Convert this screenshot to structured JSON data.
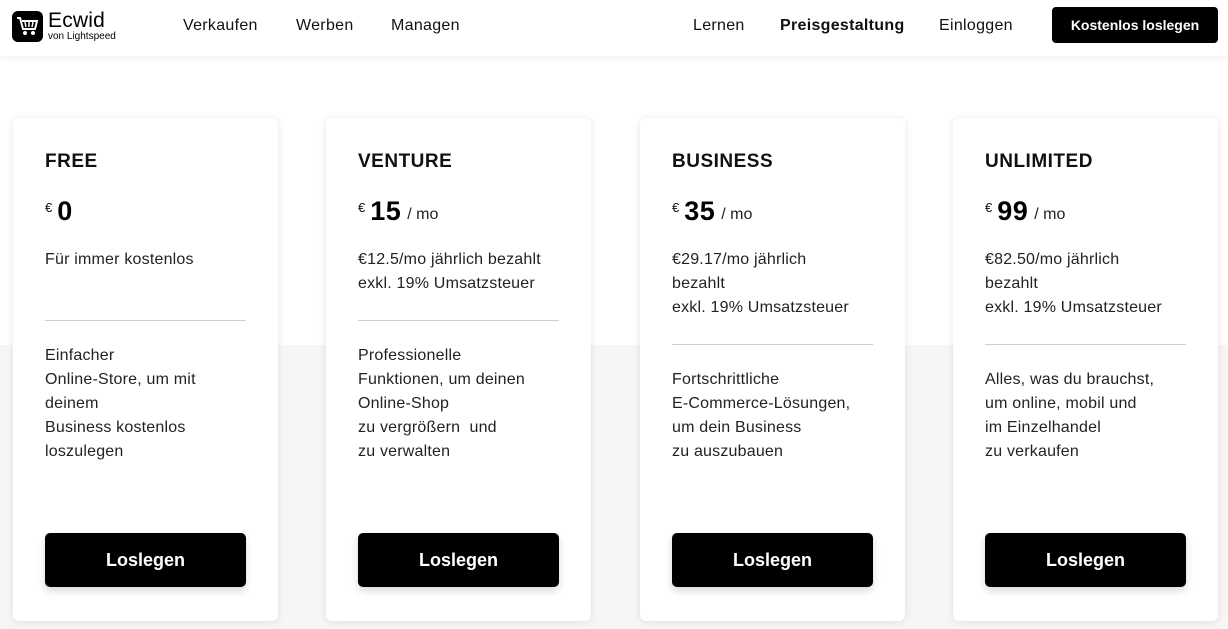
{
  "brand": {
    "name": "Ecwid",
    "sub": "von Lightspeed"
  },
  "nav": {
    "left": [
      "Verkaufen",
      "Werben",
      "Managen"
    ],
    "right": [
      "Lernen",
      "Preisgestaltung",
      "Einloggen"
    ],
    "cta": "Kostenlos loslegen"
  },
  "plans": [
    {
      "name": "FREE",
      "currency": "€",
      "amount": "0",
      "per": "",
      "sub": [
        "Für immer kostenlos"
      ],
      "desc": [
        "Einfacher",
        "Online-Store, um mit",
        "deinem",
        "Business kostenlos",
        "loszulegen"
      ],
      "button": "Loslegen"
    },
    {
      "name": "VENTURE",
      "currency": "€",
      "amount": "15",
      "per": "/ mo",
      "sub": [
        "€12.5/mo jährlich bezahlt",
        "exkl. 19% Umsatzsteuer"
      ],
      "desc": [
        "Professionelle",
        "Funktionen, um deinen",
        "Online-Shop",
        "zu vergrößern  und",
        "zu verwalten"
      ],
      "button": "Loslegen"
    },
    {
      "name": "BUSINESS",
      "currency": "€",
      "amount": "35",
      "per": "/ mo",
      "sub": [
        "€29.17/mo jährlich",
        "bezahlt",
        "exkl. 19% Umsatzsteuer"
      ],
      "desc": [
        "Fortschrittliche",
        "E-Commerce-Lösungen,",
        "um dein Business",
        "zu auszubauen"
      ],
      "button": "Loslegen"
    },
    {
      "name": "UNLIMITED",
      "currency": "€",
      "amount": "99",
      "per": "/ mo",
      "sub": [
        "€82.50/mo jährlich",
        "bezahlt",
        "exkl. 19% Umsatzsteuer"
      ],
      "desc": [
        "Alles, was du brauchst,",
        "um online, mobil und",
        "im Einzelhandel",
        "zu verkaufen"
      ],
      "button": "Loslegen"
    }
  ],
  "colors": {
    "accent": "#ffd830",
    "button": "#000000",
    "band": "#f6f6f6"
  }
}
